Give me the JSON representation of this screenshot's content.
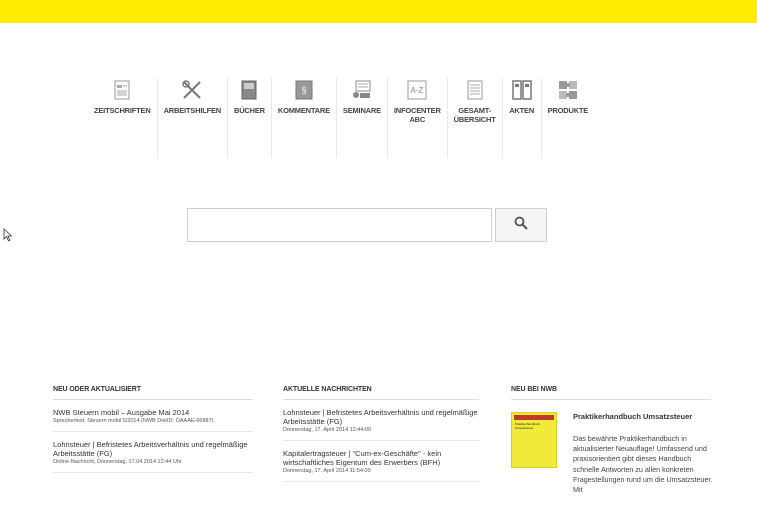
{
  "nav": {
    "items": [
      {
        "label": "ZEITSCHRIFTEN",
        "icon": "newspaper-icon"
      },
      {
        "label": "ARBEITSHILFEN",
        "icon": "tools-icon"
      },
      {
        "label": "BÜCHER",
        "icon": "book-icon"
      },
      {
        "label": "KOMMENTARE",
        "icon": "commentary-icon"
      },
      {
        "label": "SEMINARE",
        "icon": "seminar-icon"
      },
      {
        "label": "INFOCENTER\nABC",
        "icon": "az-icon"
      },
      {
        "label": "GESAMT-\nÜBERSICHT",
        "icon": "overview-icon"
      },
      {
        "label": "AKTEN",
        "icon": "files-icon"
      },
      {
        "label": "PRODUKTE",
        "icon": "puzzle-icon"
      }
    ]
  },
  "search": {
    "value": "",
    "placeholder": "",
    "icon": "search-icon"
  },
  "columns": {
    "new": {
      "heading": "NEU ODER AKTUALISIERT",
      "items": [
        {
          "title": "NWB Steuern mobil – Ausgabe Mai 2014",
          "meta": "Sprechertext, Steuern mobil 5/2014 (NWB DokID: OAAAE-66887)"
        },
        {
          "title": "Lohnsteuer | Befristetes Arbeitsverhältnis und regelmäßige Arbeitsstätte (FG)",
          "meta": "Online-Nachricht, Donnerstag, 17.04.2014 12:44 Uhr"
        }
      ]
    },
    "news": {
      "heading": "AKTUELLE NACHRICHTEN",
      "items": [
        {
          "title": "Lohnsteuer | Befristetes Arbeitsverhältnis und regelmäßige Arbeitsstätte (FG)",
          "meta": "Donnerstag, 17. April 2014 12:44:00"
        },
        {
          "title": "Kapitalertragsteuer | \"Cum-ex-Geschäfte\" - kein wirtschaftliches Eigentum des Erwerbers (BFH)",
          "meta": "Donnerstag, 17. April 2014 11:54:00"
        }
      ]
    },
    "nwb": {
      "heading": "NEU BEI NWB",
      "book_title": "Praktikerhandbuch Umsatzsteuer",
      "book_cover_text": "Praktikerhandbuch Umsatzsteuer",
      "book_desc": "Das bewährte Praktikerhandbuch in aktualisierter Neuauflage! Umfassend und praxisorientiert gibt dieses Handbuch schnelle Antworten zu allen konkreten Fragestellungen rund um die Umsatzsteuer. Mit"
    }
  },
  "colors": {
    "topbar": "#ffec00",
    "book_cover": "#f2ea3a"
  }
}
